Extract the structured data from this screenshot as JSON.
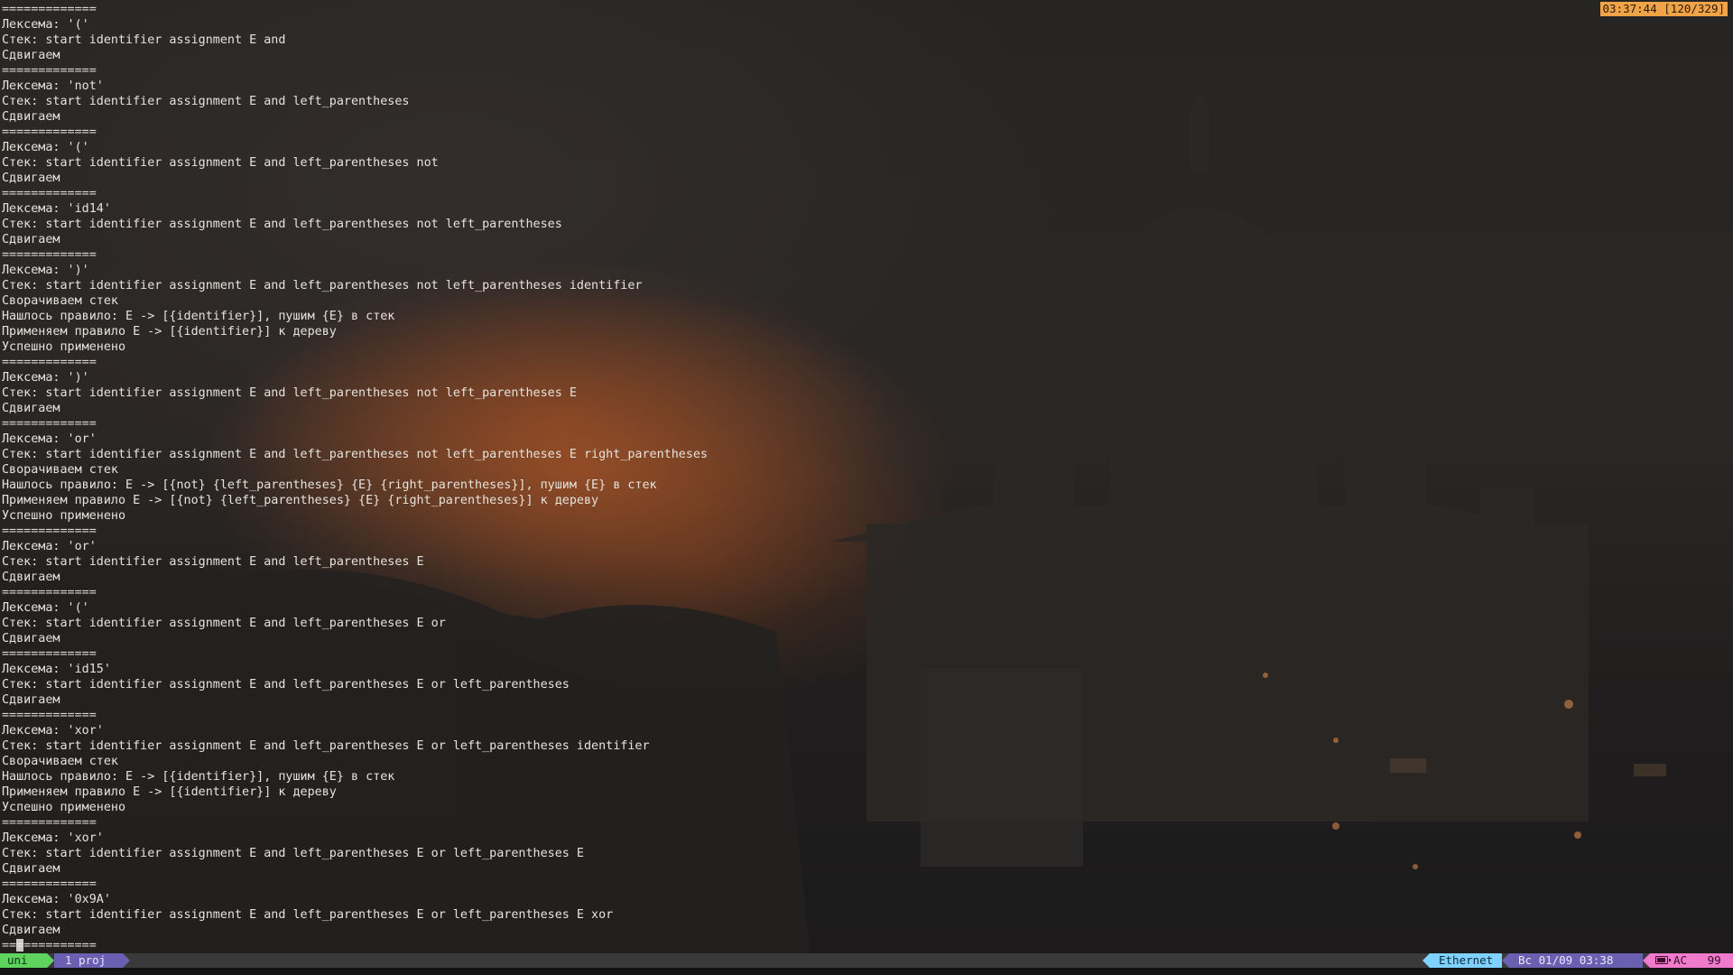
{
  "clock": "03:37:44 [120/329]",
  "terminal": {
    "lines": [
      "=============",
      "Лексема: '('",
      "Стек: start identifier assignment E and",
      "Сдвигаем",
      "=============",
      "Лексема: 'not'",
      "Стек: start identifier assignment E and left_parentheses",
      "Сдвигаем",
      "=============",
      "Лексема: '('",
      "Стек: start identifier assignment E and left_parentheses not",
      "Сдвигаем",
      "=============",
      "Лексема: 'id14'",
      "Стек: start identifier assignment E and left_parentheses not left_parentheses",
      "Сдвигаем",
      "=============",
      "Лексема: ')'",
      "Стек: start identifier assignment E and left_parentheses not left_parentheses identifier",
      "Сворачиваем стек",
      "Нашлось правило: E -> [{identifier}], пушим {E} в стек",
      "Применяем правило E -> [{identifier}] к дереву",
      "Успешно применено",
      "=============",
      "Лексема: ')'",
      "Стек: start identifier assignment E and left_parentheses not left_parentheses E",
      "Сдвигаем",
      "=============",
      "Лексема: 'or'",
      "Стек: start identifier assignment E and left_parentheses not left_parentheses E right_parentheses",
      "Сворачиваем стек",
      "Нашлось правило: E -> [{not} {left_parentheses} {E} {right_parentheses}], пушим {E} в стек",
      "Применяем правило E -> [{not} {left_parentheses} {E} {right_parentheses}] к дереву",
      "Успешно применено",
      "=============",
      "Лексема: 'or'",
      "Стек: start identifier assignment E and left_parentheses E",
      "Сдвигаем",
      "=============",
      "Лексема: '('",
      "Стек: start identifier assignment E and left_parentheses E or",
      "Сдвигаем",
      "=============",
      "Лексема: 'id15'",
      "Стек: start identifier assignment E and left_parentheses E or left_parentheses",
      "Сдвигаем",
      "=============",
      "Лексема: 'xor'",
      "Стек: start identifier assignment E and left_parentheses E or left_parentheses identifier",
      "Сворачиваем стек",
      "Нашлось правило: E -> [{identifier}], пушим {E} в стек",
      "Применяем правило E -> [{identifier}] к дереву",
      "Успешно применено",
      "=============",
      "Лексема: 'xor'",
      "Стек: start identifier assignment E and left_parentheses E or left_parentheses E",
      "Сдвигаем",
      "=============",
      "Лексема: '0x9A'",
      "Стек: start identifier assignment E and left_parentheses E or left_parentheses E xor",
      "Сдвигаем",
      "============="
    ]
  },
  "statusbar": {
    "session": "uni",
    "window": "1 proj",
    "network": "Ethernet",
    "datetime": "Вс 01/09 03:38",
    "power_label": "AC",
    "battery_percent": "99",
    "icons": {
      "battery": "battery-icon"
    },
    "colors": {
      "session": "#5ed35e",
      "window": "#6a5fb0",
      "network": "#7fd1ff",
      "datetime": "#6a5fb0",
      "battery": "#f07acb",
      "clock": "#f0a44a"
    }
  }
}
